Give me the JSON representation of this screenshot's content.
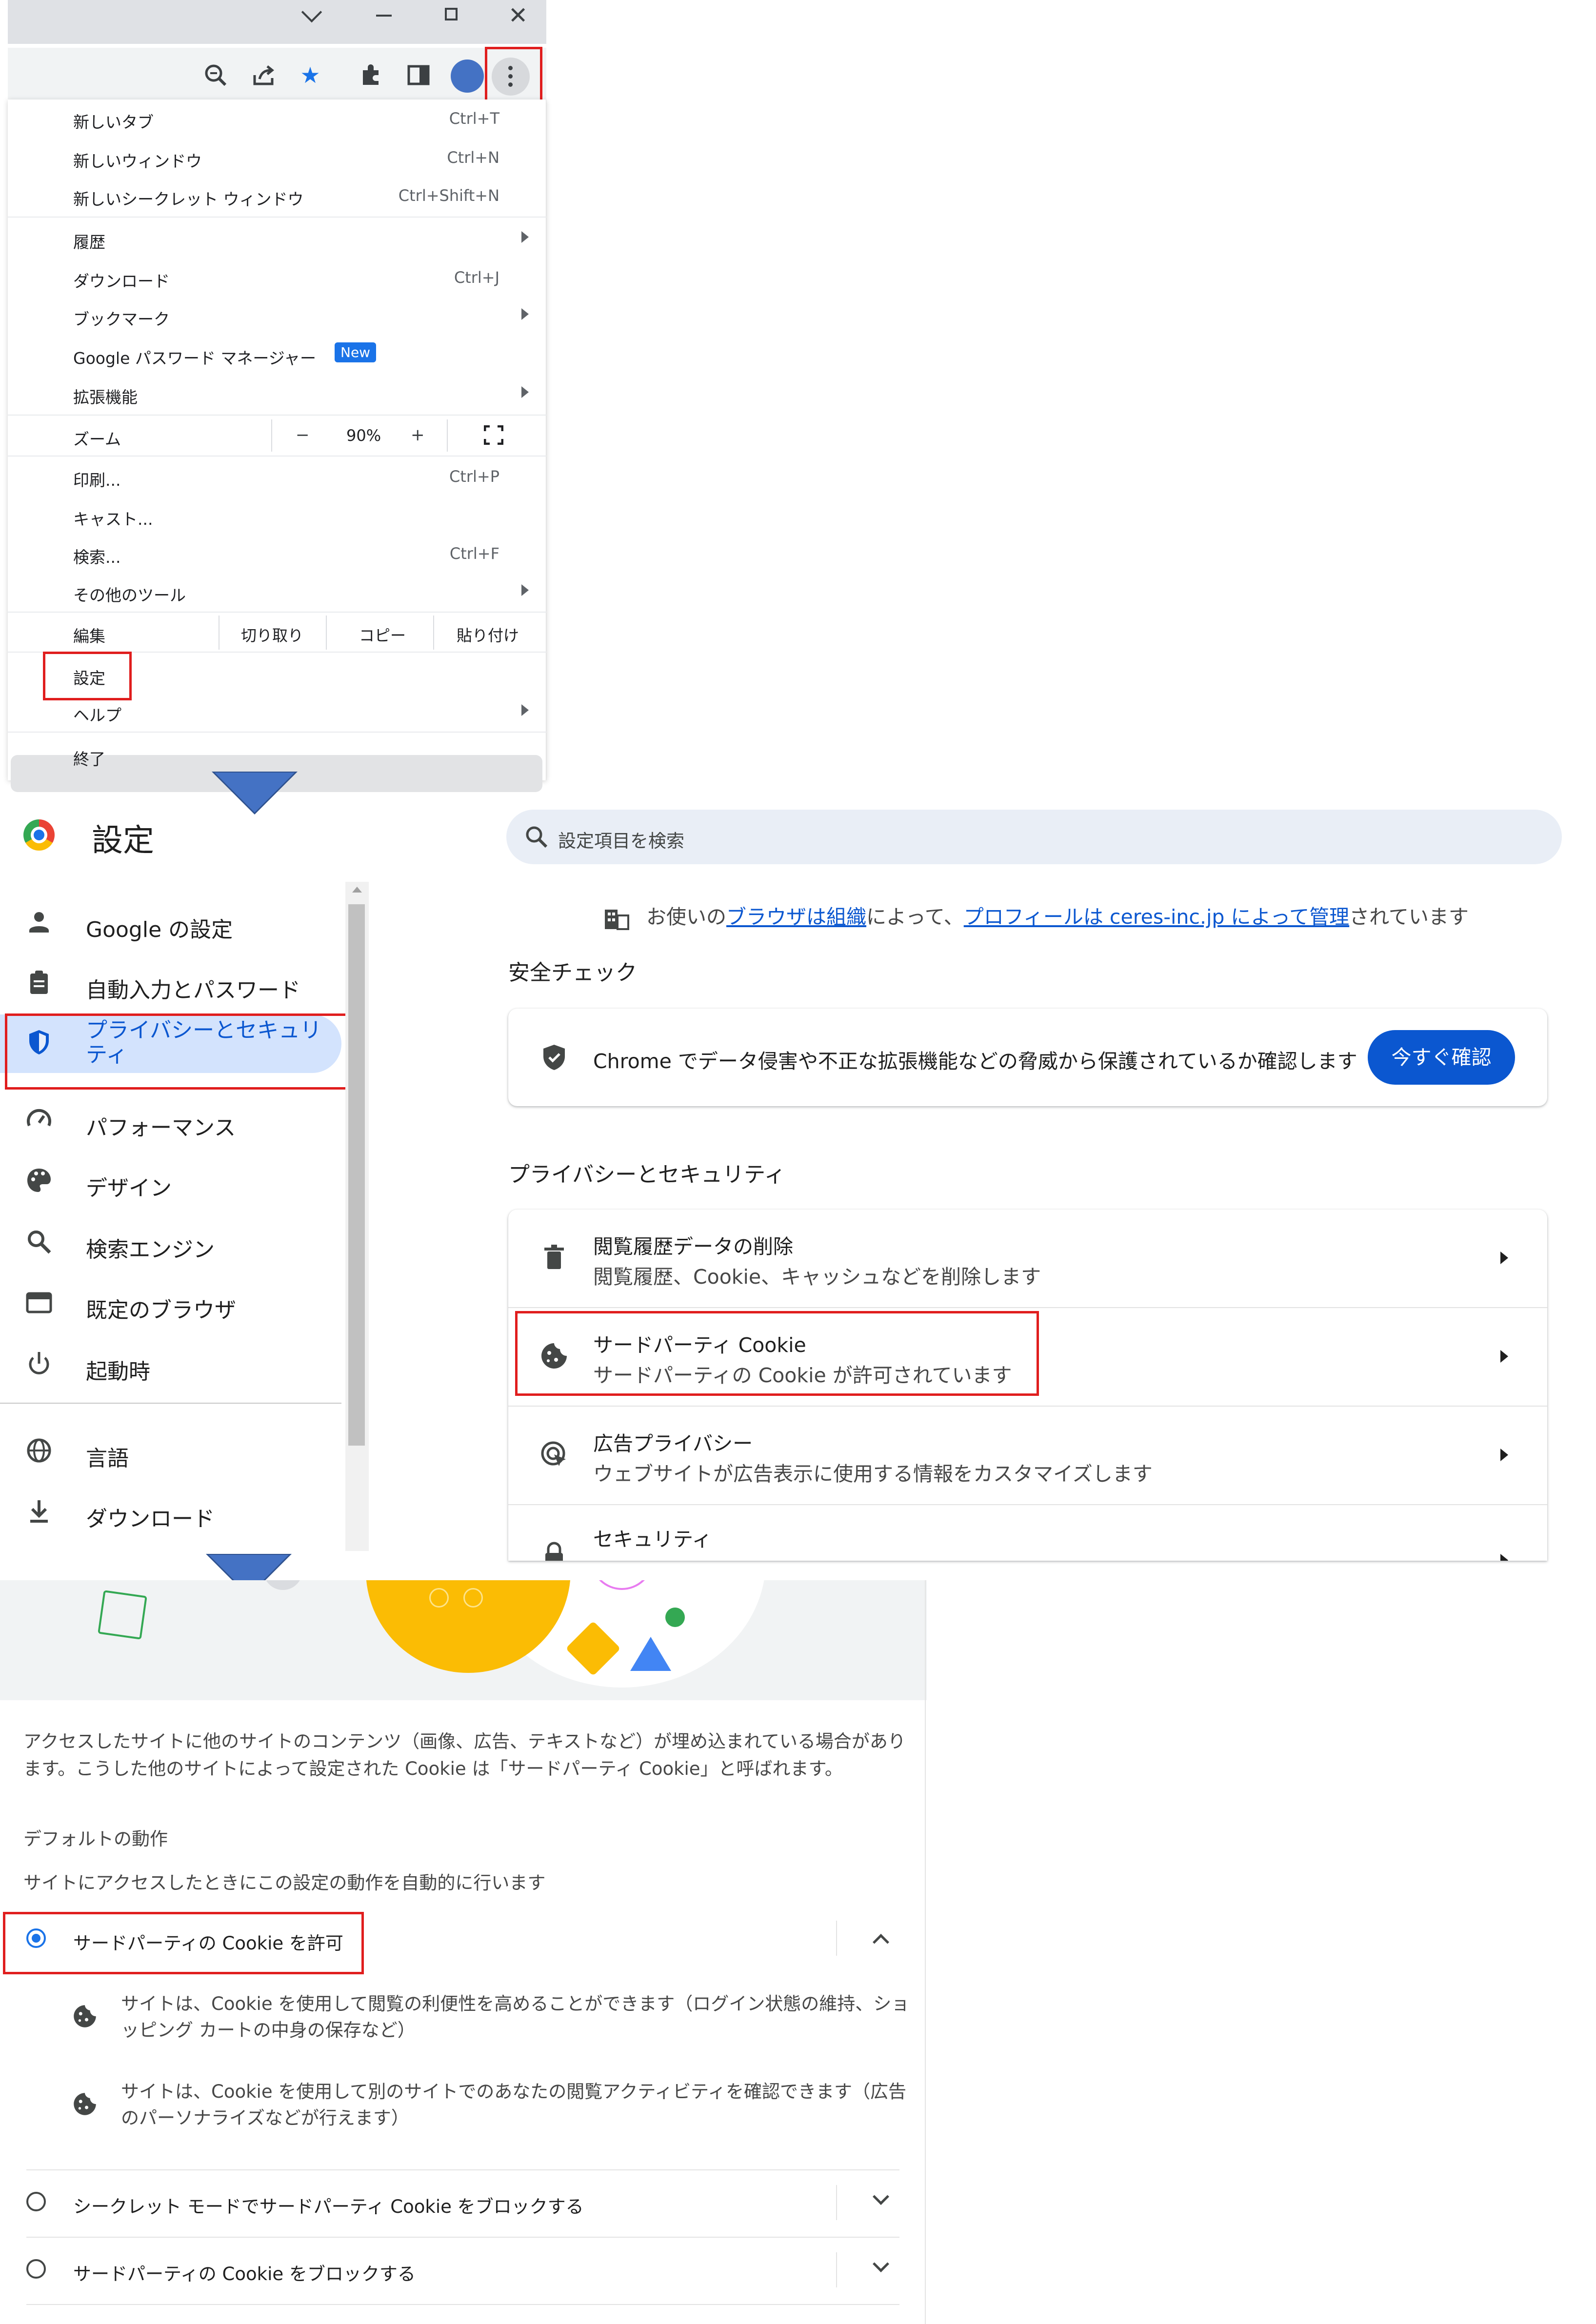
{
  "menu": {
    "items": [
      {
        "label": "新しいタブ",
        "shortcut": "Ctrl+T"
      },
      {
        "label": "新しいウィンドウ",
        "shortcut": "Ctrl+N"
      },
      {
        "label": "新しいシークレット ウィンドウ",
        "shortcut": "Ctrl+Shift+N"
      },
      {
        "label": "履歴",
        "shortcut": ""
      },
      {
        "label": "ダウンロード",
        "shortcut": "Ctrl+J"
      },
      {
        "label": "ブックマーク",
        "shortcut": ""
      },
      {
        "label": "Google パスワード マネージャー",
        "shortcut": ""
      },
      {
        "label": "拡張機能",
        "shortcut": ""
      },
      {
        "label": "ズーム",
        "shortcut": ""
      },
      {
        "label": "印刷...",
        "shortcut": "Ctrl+P"
      },
      {
        "label": "キャスト...",
        "shortcut": ""
      },
      {
        "label": "検索...",
        "shortcut": "Ctrl+F"
      },
      {
        "label": "その他のツール",
        "shortcut": ""
      },
      {
        "label": "編集",
        "shortcut": ""
      },
      {
        "label": "設定",
        "shortcut": ""
      },
      {
        "label": "ヘルプ",
        "shortcut": ""
      },
      {
        "label": "終了",
        "shortcut": ""
      }
    ],
    "new_badge": "New",
    "zoom_minus": "−",
    "zoom_value": "90%",
    "zoom_plus": "+",
    "edit_cut": "切り取り",
    "edit_copy": "コピー",
    "edit_paste": "貼り付け"
  },
  "settings": {
    "title": "設定",
    "search_placeholder": "設定項目を検索",
    "managed_notice": {
      "prefix": "お使いの",
      "link1": "ブラウザは組織",
      "middle": "によって、",
      "link2": "プロフィールは ceres-inc.jp によって管理",
      "suffix": "されています"
    },
    "nav": [
      {
        "label": "Google の設定",
        "icon": "person-icon"
      },
      {
        "label": "自動入力とパスワード",
        "icon": "clipboard-icon"
      },
      {
        "label": "プライバシーとセキュリティ",
        "icon": "shield-icon"
      },
      {
        "label": "パフォーマンス",
        "icon": "speedometer-icon"
      },
      {
        "label": "デザイン",
        "icon": "palette-icon"
      },
      {
        "label": "検索エンジン",
        "icon": "search-icon"
      },
      {
        "label": "既定のブラウザ",
        "icon": "browser-icon"
      },
      {
        "label": "起動時",
        "icon": "power-icon"
      },
      {
        "label": "言語",
        "icon": "globe-icon"
      },
      {
        "label": "ダウンロード",
        "icon": "download-icon"
      }
    ],
    "safety_heading": "安全チェック",
    "safety_text": "Chrome でデータ侵害や不正な拡張機能などの脅威から保護されているか確認します",
    "safety_button": "今すぐ確認",
    "privacy_heading": "プライバシーとセキュリティ",
    "privacy_rows": [
      {
        "title": "閲覧履歴データの削除",
        "subtitle": "閲覧履歴、Cookie、キャッシュなどを削除します"
      },
      {
        "title": "サードパーティ Cookie",
        "subtitle": "サードパーティの Cookie が許可されています"
      },
      {
        "title": "広告プライバシー",
        "subtitle": "ウェブサイトが広告表示に使用する情報をカスタマイズします"
      },
      {
        "title": "セキュリティ",
        "subtitle": ""
      }
    ]
  },
  "cookies": {
    "intro_line1": "アクセスしたサイトに他のサイトのコンテンツ（画像、広告、テキストなど）が埋め込まれている場合があり",
    "intro_line2": "ます。こうした他のサイトによって設定された Cookie は「サードパーティ Cookie」と呼ばれます。",
    "default_heading": "デフォルトの動作",
    "default_sub": "サイトにアクセスしたときにこの設定の動作を自動的に行います",
    "options": [
      {
        "label": "サードパーティの Cookie を許可",
        "selected": true
      },
      {
        "label": "シークレット モードでサードパーティ Cookie をブロックする",
        "selected": false
      },
      {
        "label": "サードパーティの Cookie をブロックする",
        "selected": false
      }
    ],
    "allow_details": [
      {
        "line1": "サイトは、Cookie を使用して閲覧の利便性を高めることができます（ログイン状態の維持、ショ",
        "line2": "ッピング カートの中身の保存など）"
      },
      {
        "line1": "サイトは、Cookie を使用して別のサイトでのあなたの閲覧アクティビティを確認できます（広告",
        "line2": "のパーソナライズなどが行えます）"
      }
    ]
  },
  "colors": {
    "accent": "#1a73e8",
    "highlight_red": "#e01e1e",
    "arrow_blue": "#4472c4",
    "nav_selected_bg": "#d3e3fd"
  }
}
